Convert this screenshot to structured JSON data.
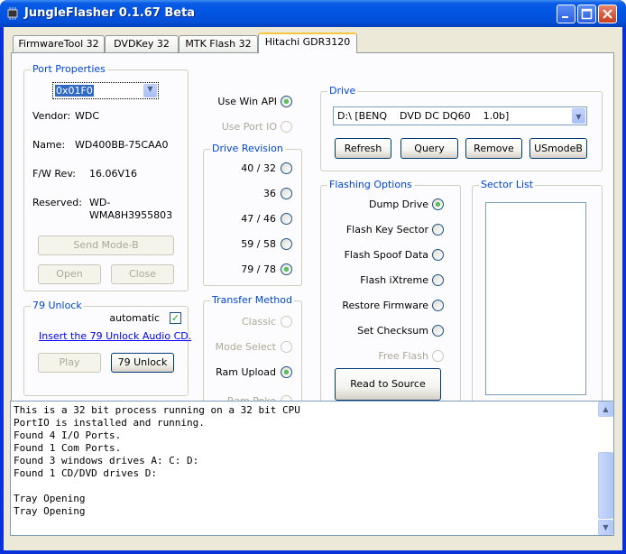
{
  "window": {
    "title": "JungleFlasher 0.1.67 Beta",
    "minimize": "_",
    "maximize": "□",
    "close": "✕"
  },
  "tabs": [
    {
      "label": "FirmwareTool 32"
    },
    {
      "label": "DVDKey 32"
    },
    {
      "label": "MTK Flash 32"
    },
    {
      "label": "Hitachi GDR3120",
      "active": true
    }
  ],
  "port_properties": {
    "legend": "Port Properties",
    "port_select": "0x01F0",
    "vendor_label": "Vendor:",
    "vendor_value": "WDC",
    "name_label": "Name:",
    "name_value": "WD400BB-75CAA0",
    "fw_label": "F/W Rev:",
    "fw_value": "16.06V16",
    "reserved_label": "Reserved:",
    "reserved_value_1": "WD-",
    "reserved_value_2": "WMA8H3955803",
    "send_mode_b": "Send Mode-B",
    "open": "Open",
    "close": "Close"
  },
  "api": {
    "use_win_api": "Use Win API",
    "use_port_io": "Use Port IO",
    "selected": "use_win_api"
  },
  "drive_revision": {
    "legend": "Drive Revision",
    "options": [
      "40 / 32",
      "36",
      "47 / 46",
      "59 / 58",
      "79 / 78"
    ],
    "selected": "79 / 78"
  },
  "transfer_method": {
    "legend": "Transfer Method",
    "classic": "Classic",
    "mode_select": "Mode Select",
    "ram_upload": "Ram Upload",
    "ram_poke": "Ram Poke",
    "selected": "Ram Upload"
  },
  "unlock79": {
    "legend": "79 Unlock",
    "automatic": "automatic",
    "automatic_checked": true,
    "insert_link": "Insert the 79 Unlock Audio CD.",
    "play": "Play",
    "unlock": "79 Unlock"
  },
  "drive": {
    "legend": "Drive",
    "selected": "D:\\ [BENQ    DVD DC DQ60    1.0b]",
    "refresh": "Refresh",
    "query": "Query",
    "remove": "Remove",
    "usmodeb": "USmodeB"
  },
  "flashing_options": {
    "legend": "Flashing Options",
    "dump_drive": "Dump Drive",
    "flash_key_sector": "Flash Key Sector",
    "flash_spoof_data": "Flash Spoof Data",
    "flash_ixtreme": "Flash iXtreme",
    "restore_firmware": "Restore Firmware",
    "set_checksum": "Set Checksum",
    "free_flash": "Free Flash",
    "selected": "Dump Drive",
    "read_to_source": "Read to Source"
  },
  "sector_list": {
    "legend": "Sector List"
  },
  "console": {
    "lines": [
      "This is a 32 bit process running on a 32 bit CPU",
      "PortIO is installed and running.",
      "Found 4 I/O Ports.",
      "Found 1 Com Ports.",
      "Found 3 windows drives A: C: D:",
      "Found 1 CD/DVD drives D:",
      "",
      "Tray Opening",
      "Tray Opening"
    ]
  },
  "icons": {
    "app": "chip-icon",
    "dropdown": "chevron-down-icon",
    "scroll_up": "chevron-up-icon"
  },
  "colors": {
    "titlebar": "#0054e3",
    "group_label": "#0046d5",
    "link": "#0000ff",
    "tab_highlight": "#ffc83c",
    "radio_on": "#21a121"
  }
}
